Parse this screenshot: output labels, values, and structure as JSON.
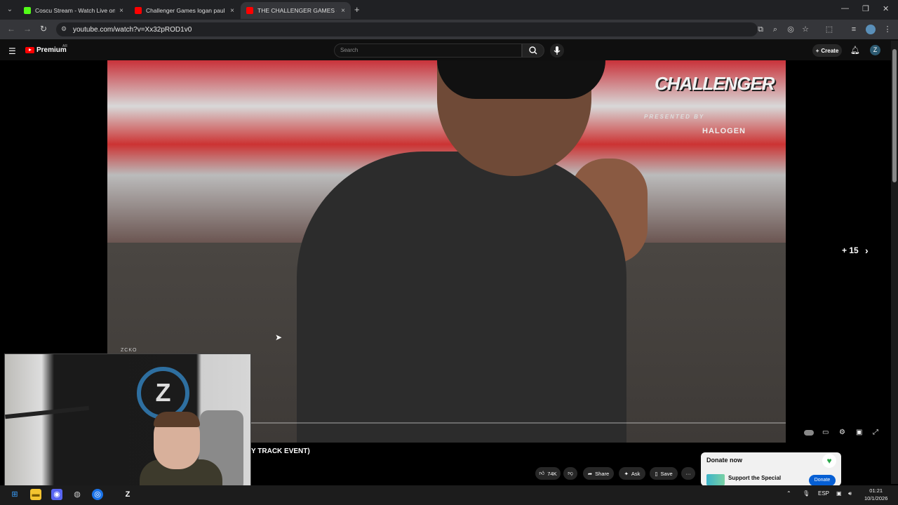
{
  "browser": {
    "tabs": [
      {
        "title": "Coscu Stream - Watch Live on",
        "favicon_color": "#53fc18",
        "active": false
      },
      {
        "title": "Challenger Games logan paul",
        "favicon_color": "#ff0000",
        "active": false
      },
      {
        "title": "THE CHALLENGER GAMES - PR",
        "favicon_color": "#ff0000",
        "active": true
      }
    ],
    "new_tab": "+",
    "tab_close": "×",
    "url": "youtube.com/watch?v=Xx32pROD1v0"
  },
  "youtube": {
    "brand": "Premium",
    "region": "AR",
    "search_placeholder": "Search",
    "create_label": "Create",
    "avatar_letter": "Z"
  },
  "video": {
    "overlay_logo": "CHALLENGER",
    "overlay_presented": "PRESENTED BY",
    "overlay_sponsor": "HALOGEN",
    "skip_label": "+ 15",
    "title_fragment": "Y TRACK EVENT)"
  },
  "actions": {
    "like_count": "74K",
    "share_label": "Share",
    "ask_label": "Ask",
    "save_label": "Save",
    "more_label": "···"
  },
  "donate": {
    "title": "Donate now",
    "subtitle": "Support the Special",
    "button": "Donate"
  },
  "webcam": {
    "label": "ZCKO"
  },
  "taskbar": {
    "language": "ESP",
    "time": "01:21",
    "date": "10/1/2026"
  }
}
